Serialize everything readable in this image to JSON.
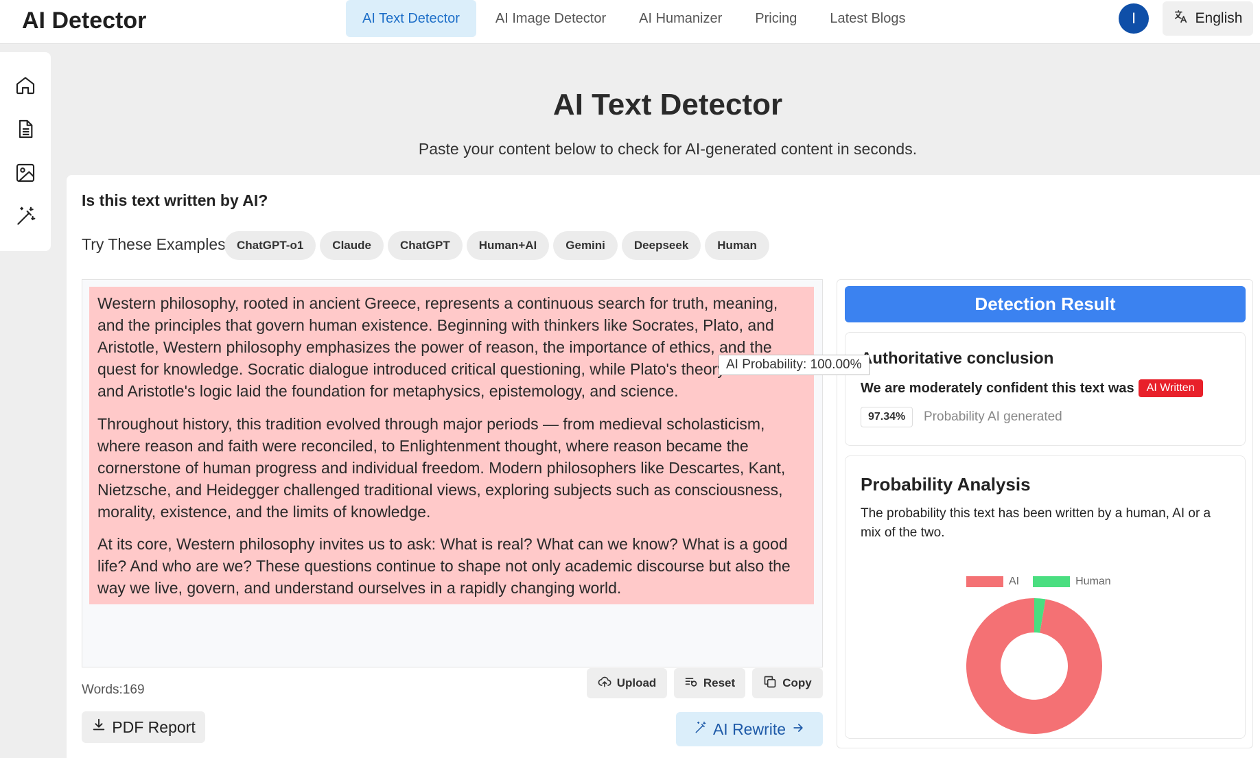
{
  "app": {
    "logo": "AI Detector"
  },
  "nav": {
    "items": [
      {
        "label": "AI Text Detector",
        "active": true
      },
      {
        "label": "AI Image Detector"
      },
      {
        "label": "AI Humanizer"
      },
      {
        "label": "Pricing"
      },
      {
        "label": "Latest Blogs"
      }
    ],
    "avatar_letter": "I",
    "language": "English"
  },
  "sidebar": {
    "items": [
      "home-icon",
      "document-icon",
      "image-icon",
      "magic-wand-icon"
    ]
  },
  "hero": {
    "title": "AI Text Detector",
    "subtitle": "Paste your content below to check for AI-generated content in seconds."
  },
  "form": {
    "question": "Is this text written by AI?",
    "examples_label": "Try These Examples:",
    "examples": [
      "ChatGPT-o1",
      "Claude",
      "ChatGPT",
      "Human+AI",
      "Gemini",
      "Deepseek",
      "Human"
    ],
    "paragraphs": [
      "Western philosophy, rooted in ancient Greece, represents a continuous search for truth, meaning, and the principles that govern human existence. Beginning with thinkers like Socrates, Plato, and Aristotle, Western philosophy emphasizes the power of reason, the importance of ethics, and the quest for knowledge. Socratic dialogue introduced critical questioning, while Plato's theory of forms and Aristotle's logic laid the foundation for metaphysics, epistemology, and science.",
      "Throughout history, this tradition evolved through major periods — from medieval scholasticism, where reason and faith were reconciled, to Enlightenment thought, where reason became the cornerstone of human progress and individual freedom. Modern philosophers like Descartes, Kant, Nietzsche, and Heidegger challenged traditional views, exploring subjects such as consciousness, morality, existence, and the limits of knowledge.",
      "At its core, Western philosophy invites us to ask: What is real? What can we know? What is a good life? And who are we? These questions continue to shape not only academic discourse but also the way we live, govern, and understand ourselves in a rapidly changing world."
    ],
    "tooltip": "AI Probability: 100.00%",
    "word_count": "Words:169",
    "buttons": {
      "upload": "Upload",
      "reset": "Reset",
      "copy": "Copy",
      "pdf": "PDF Report",
      "rewrite": "AI Rewrite"
    }
  },
  "result": {
    "header": "Detection Result",
    "conclusion_title": "Authoritative conclusion",
    "conclusion_text": "We are moderately confident this text was",
    "badge": "AI Written",
    "probability": "97.34%",
    "probability_label": "Probability AI generated",
    "analysis_title": "Probability Analysis",
    "analysis_desc": "The probability this text has been written by a human, AI or a mix of the two.",
    "colors": {
      "ai": "#f47174",
      "human": "#4ade80",
      "badge": "#e8202a",
      "header": "#3b82f0"
    }
  },
  "chart_data": {
    "type": "pie",
    "categories": [
      "AI",
      "Human"
    ],
    "values": [
      97.34,
      2.66
    ]
  }
}
